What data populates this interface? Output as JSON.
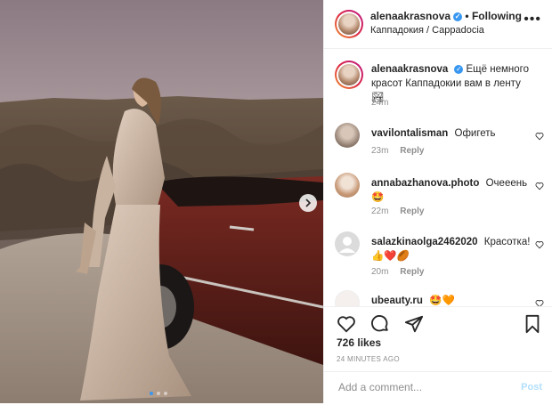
{
  "post": {
    "username": "alenaakrasnova",
    "verified_mark": "✓",
    "follow_separator": "•",
    "follow_label": "Following",
    "location": "Каппадокия / Cappadocia",
    "more_label": "•••"
  },
  "caption": {
    "username": "alenaakrasnova",
    "text": "Ещё немного красот Каппадокии вам в ленту 🏞",
    "age": "24m"
  },
  "comments": [
    {
      "username": "vavilontalisman",
      "text": "Офигеть",
      "age": "23m",
      "reply": "Reply"
    },
    {
      "username": "annabazhanova.photo",
      "text": "Очееень 🤩",
      "age": "22m",
      "reply": "Reply"
    },
    {
      "username": "salazkinaolga2462020",
      "text": "Красотка! 👍❤️🏉",
      "age": "20m",
      "reply": "Reply"
    },
    {
      "username": "ubeauty.ru",
      "text": "🤩🧡",
      "age": "",
      "reply": ""
    }
  ],
  "actions": {
    "icons": [
      "heart-icon",
      "comment-icon",
      "share-icon",
      "bookmark-icon"
    ]
  },
  "likes": "726 likes",
  "timestamp": "24 MINUTES AGO",
  "add_comment": {
    "placeholder": "Add a comment...",
    "post_label": "Post"
  },
  "carousel": {
    "dots": 3,
    "active": 0
  },
  "colors": {
    "accent": "#3897f0",
    "post_disabled": "#b2dffc",
    "muted": "#8e8e8e",
    "text": "#262626"
  }
}
